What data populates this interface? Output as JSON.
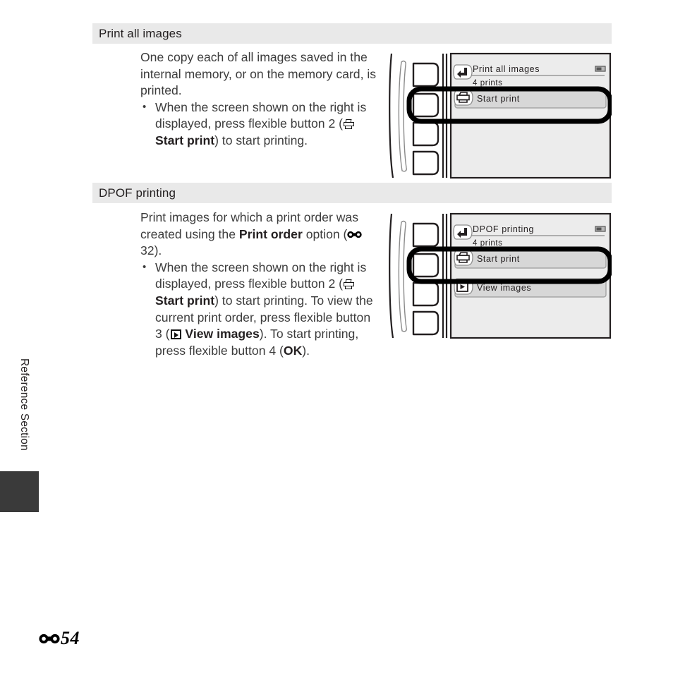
{
  "document": {
    "page_number": "54",
    "page_prefix_icon": "reference-section-symbol",
    "side_tab_label": "Reference Section"
  },
  "sections": [
    {
      "id": "print-all-images",
      "heading": "Print all images",
      "paragraphs": [
        "One copy each of all images saved in the internal memory, or on the memory card, is printed."
      ],
      "bullets": [
        {
          "parts": [
            {
              "type": "text",
              "text": "When the screen shown on the right is displayed, press flexible button 2 ("
            },
            {
              "type": "icon",
              "icon": "printer-icon"
            },
            {
              "type": "bold",
              "text": " Start print"
            },
            {
              "type": "text",
              "text": ") to start printing."
            }
          ]
        }
      ],
      "screen": {
        "title": "Print all images",
        "subtitle": "4 prints",
        "battery_icon": "battery-icon",
        "back_icon": "back-arrow-icon",
        "items": [
          {
            "label": "Start print",
            "icon": "printer-icon",
            "highlighted": true
          }
        ],
        "buttons": [
          "flexible-button-1",
          "flexible-button-2",
          "flexible-button-3",
          "flexible-button-4"
        ],
        "highlighted_button_index": 1
      }
    },
    {
      "id": "dpof-printing",
      "heading": "DPOF printing",
      "paragraphs": [],
      "paragraph_parts": [
        {
          "type": "text",
          "text": "Print images for which a print order was created using the "
        },
        {
          "type": "bold",
          "text": "Print order"
        },
        {
          "type": "text",
          "text": " option ("
        },
        {
          "type": "icon",
          "icon": "reference-section-symbol"
        },
        {
          "type": "text",
          "text": "32)."
        }
      ],
      "bullets": [
        {
          "parts": [
            {
              "type": "text",
              "text": "When the screen shown on the right is displayed, press flexible button 2 ("
            },
            {
              "type": "icon",
              "icon": "printer-icon"
            },
            {
              "type": "bold",
              "text": " Start print"
            },
            {
              "type": "text",
              "text": ") to start printing. To view the current print order, press flexible button 3 ("
            },
            {
              "type": "icon",
              "icon": "play-icon"
            },
            {
              "type": "bold",
              "text": " View images"
            },
            {
              "type": "text",
              "text": "). To start printing, press flexible button 4 ("
            },
            {
              "type": "bold",
              "text": "OK"
            },
            {
              "type": "text",
              "text": ")."
            }
          ]
        }
      ],
      "screen": {
        "title": "DPOF printing",
        "subtitle": "4 prints",
        "battery_icon": "battery-icon",
        "back_icon": "back-arrow-icon",
        "items": [
          {
            "label": "Start print",
            "icon": "printer-icon",
            "highlighted": true
          },
          {
            "label": "View images",
            "icon": "play-icon",
            "highlighted": false
          }
        ],
        "buttons": [
          "flexible-button-1",
          "flexible-button-2",
          "flexible-button-3",
          "flexible-button-4"
        ],
        "highlighted_button_index": 1
      }
    }
  ],
  "colors": {
    "header_bar": "#e9e9e9",
    "body_text": "#3c3c3c",
    "heading_text": "#231f20",
    "screen_bg": "#ececec",
    "menu_item_bg": "#d7d7d7",
    "tab_block": "#3a3a3a"
  }
}
